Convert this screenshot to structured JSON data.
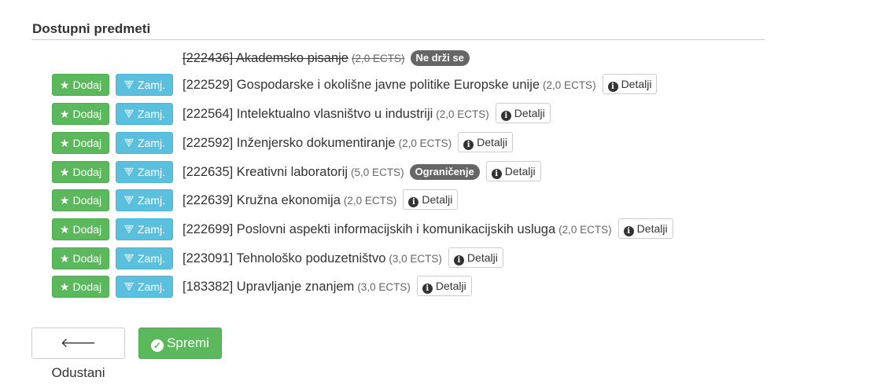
{
  "section": {
    "title": "Dostupni predmeti"
  },
  "labels": {
    "add": "Dodaj",
    "swap": "Zamj.",
    "details": "Detalji"
  },
  "icons": {
    "add": "star-icon",
    "swap": "swap-icon",
    "details": "info-icon",
    "back": "arrow-left-icon",
    "save": "check-circle-icon"
  },
  "courses": [
    {
      "code": "[222436] Akademsko pisanje",
      "ects": "(2,0 ECTS)",
      "badge": "Ne drži se",
      "disabled": true
    },
    {
      "code": "[222529] Gospodarske i okolišne javne politike Europske unije",
      "ects": "(2,0 ECTS)"
    },
    {
      "code": "[222564] Intelektualno vlasništvo u industriji",
      "ects": "(2,0 ECTS)"
    },
    {
      "code": "[222592] Inženjersko dokumentiranje",
      "ects": "(2,0 ECTS)"
    },
    {
      "code": "[222635] Kreativni laboratorij",
      "ects": "(5,0 ECTS)",
      "badge": "Ograničenje"
    },
    {
      "code": "[222639] Kružna ekonomija",
      "ects": "(2,0 ECTS)"
    },
    {
      "code": "[222699] Poslovni aspekti informacijskih i komunikacijskih usluga",
      "ects": "(2,0 ECTS)"
    },
    {
      "code": "[223091] Tehnološko poduzetništvo",
      "ects": "(3,0 ECTS)"
    },
    {
      "code": "[183382] Upravljanje znanjem",
      "ects": "(3,0 ECTS)"
    }
  ],
  "footer": {
    "cancel": "Odustani",
    "save": "Spremi"
  },
  "colors": {
    "success": "#5cb85c",
    "info": "#5bc0de",
    "badge": "#666666"
  }
}
